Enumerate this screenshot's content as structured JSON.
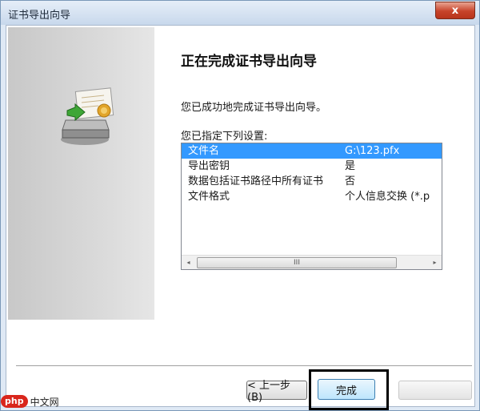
{
  "window": {
    "title": "证书导出向导",
    "close_label": "x"
  },
  "main": {
    "heading": "正在完成证书导出向导",
    "success_message": "您已成功地完成证书导出向导。",
    "settings_label": "您已指定下列设置:",
    "settings": [
      {
        "name": "文件名",
        "value": "G:\\123.pfx",
        "selected": true
      },
      {
        "name": "导出密钥",
        "value": "是"
      },
      {
        "name": "数据包括证书路径中所有证书",
        "value": "否"
      },
      {
        "name": "文件格式",
        "value": "个人信息交换 (*.p"
      }
    ],
    "scroll_left": "◂",
    "scroll_right": "▸",
    "scroll_grip": "III"
  },
  "buttons": {
    "back_label": "< 上一步 (B)",
    "finish_label": "完成"
  },
  "watermark": {
    "logo": "php",
    "text": "中文网"
  },
  "colors": {
    "selection": "#3399ff",
    "highlight_box": "#000000",
    "side_panel": "#d4d4d4"
  }
}
